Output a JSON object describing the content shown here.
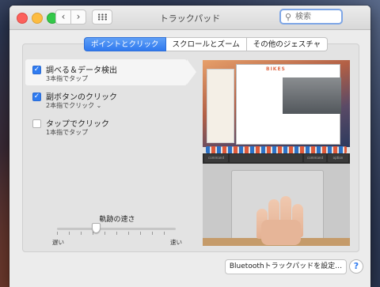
{
  "window": {
    "title": "トラックパッド",
    "nav_back": "‹",
    "nav_forward": "›"
  },
  "search": {
    "placeholder": "検索",
    "icon": "search-icon"
  },
  "tabs": [
    {
      "label": "ポイントとクリック",
      "active": true
    },
    {
      "label": "スクロールとズーム",
      "active": false
    },
    {
      "label": "その他のジェスチャ",
      "active": false
    }
  ],
  "options": [
    {
      "title": "調べる＆データ検出",
      "subtitle": "3本指でタップ",
      "checked": true,
      "selected": true
    },
    {
      "title": "副ボタンのクリック",
      "subtitle": "2本指でクリック ⌄",
      "checked": true,
      "selected": false
    },
    {
      "title": "タップでクリック",
      "subtitle": "1本指でタップ",
      "checked": false,
      "selected": false
    }
  ],
  "tracking_speed": {
    "label": "軌跡の速さ",
    "min_label": "遅い",
    "max_label": "速い",
    "value_fraction": 0.33
  },
  "preview": {
    "screen_text": "BIKES",
    "keys": [
      "command",
      "command",
      "option"
    ]
  },
  "buttons": {
    "bluetooth_setup": "Bluetoothトラックパッドを設定…",
    "help": "?"
  },
  "colors": {
    "accent": "#2f7bf0",
    "close": "#fc605b",
    "minimize": "#fdbc40",
    "maximize": "#34c84a"
  }
}
